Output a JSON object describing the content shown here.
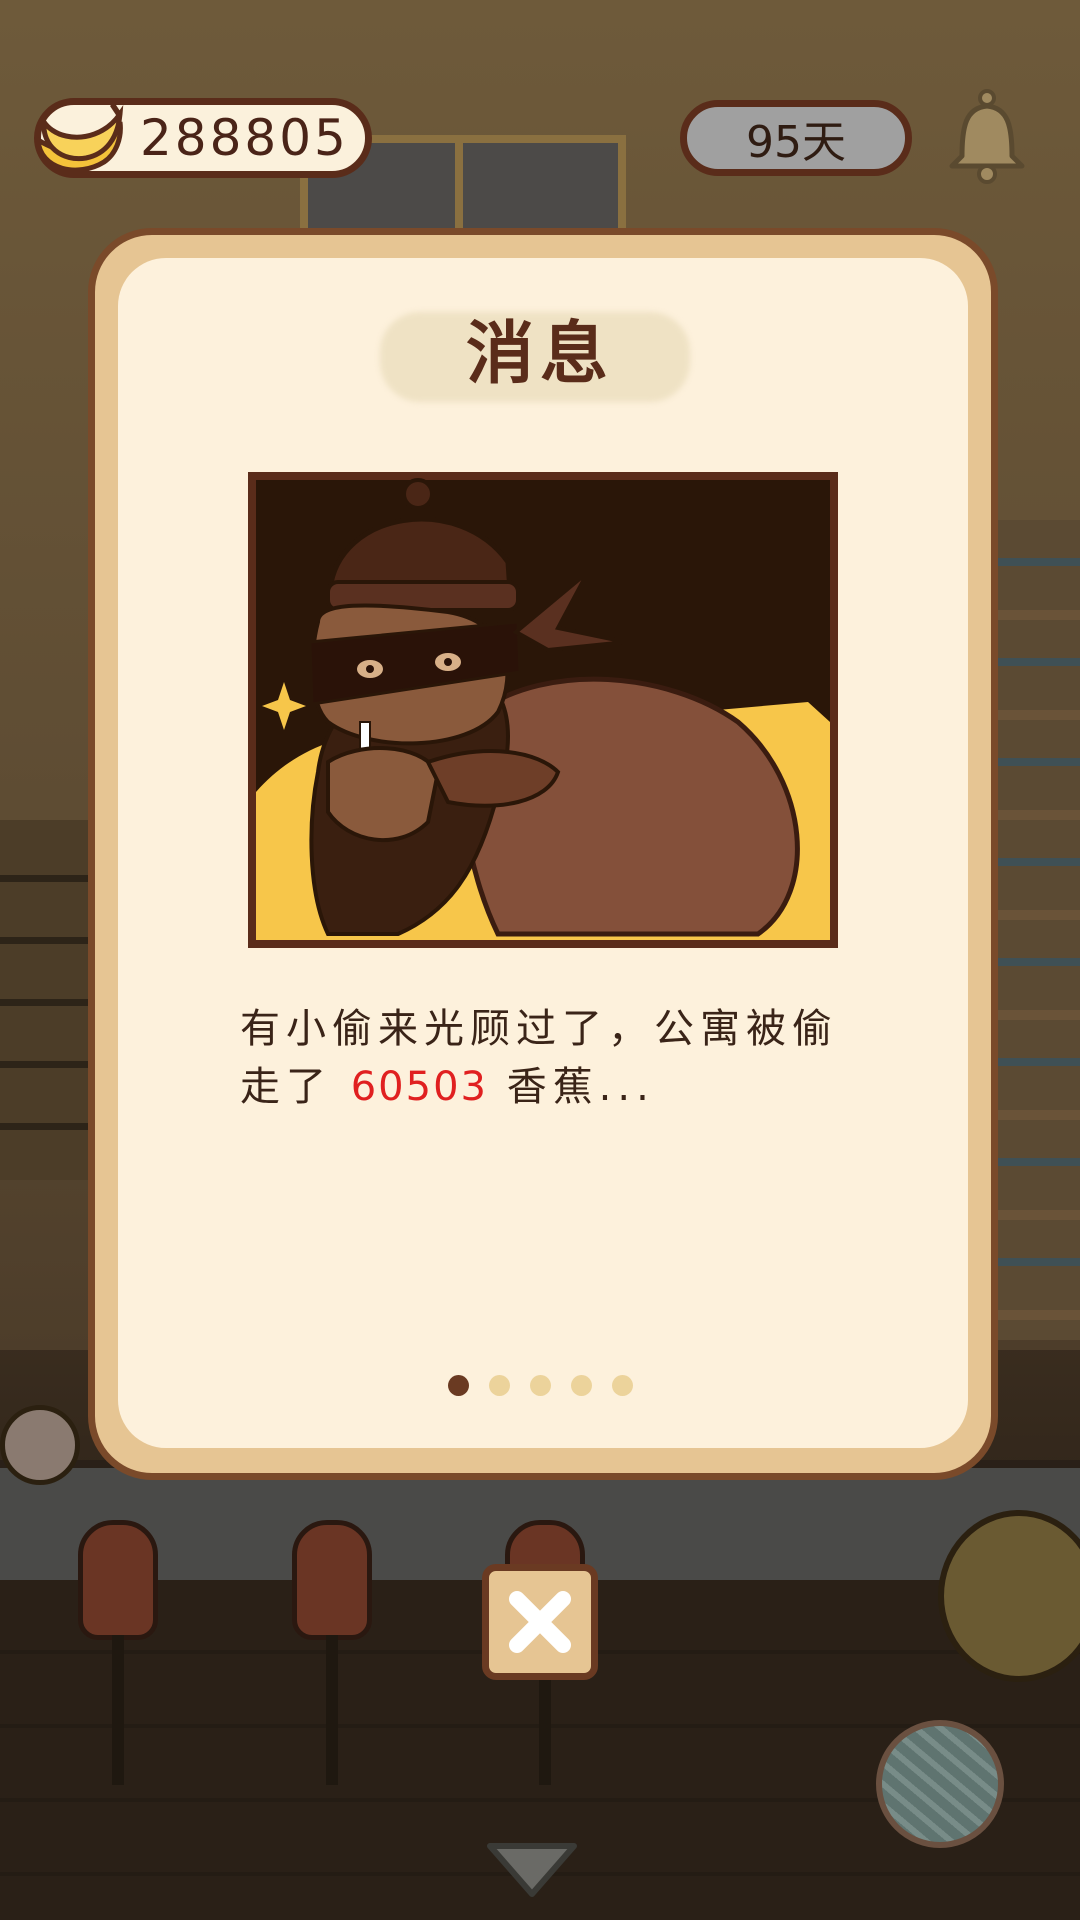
{
  "hud": {
    "banana_count": "288805",
    "days": "95天",
    "currency_icon": "banana-icon",
    "notification_icon": "bell-icon"
  },
  "modal": {
    "title": "消息",
    "message_before": "有小偷来光顾过了，公寓被偷走了",
    "stolen_amount": "60503",
    "message_after": "香蕉...",
    "page_count": 5,
    "current_page": 1,
    "close_icon": "close-icon"
  },
  "colors": {
    "accent_brown": "#5a2c1a",
    "modal_bg": "#fdf1dc",
    "modal_frame": "#e6c593",
    "highlight_red": "#e02020"
  }
}
